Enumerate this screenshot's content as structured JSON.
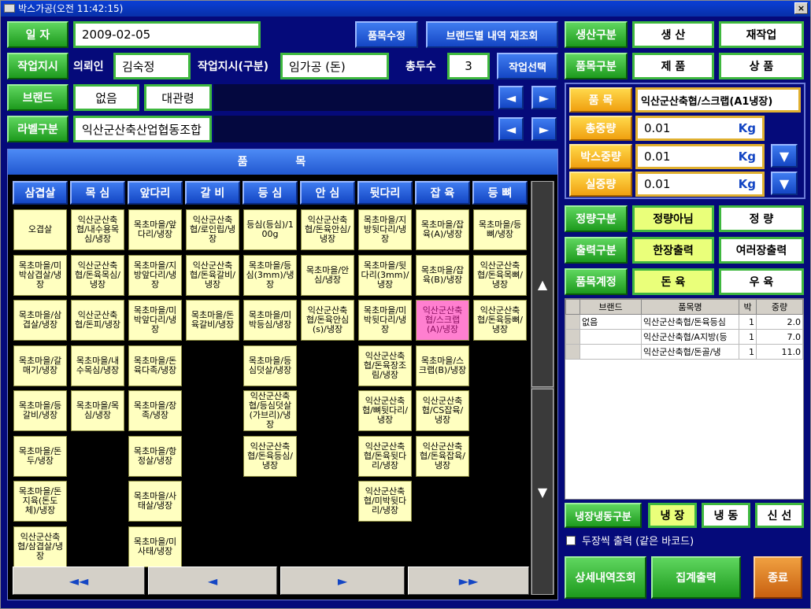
{
  "window": {
    "title": "박스가공(오전 11:42:15)",
    "close": "×"
  },
  "row1": {
    "date_label": "일 자",
    "date_value": "2009-02-05",
    "edit_btn": "품목수정",
    "brand_btn": "브랜드별 내역 재조회"
  },
  "row2": {
    "order_label": "작업지시",
    "client_label": "의뢰인",
    "client_value": "김숙정",
    "type_label": "작업지시(구분)",
    "type_value": "임가공 (돈)",
    "total_label": "총두수",
    "total_value": "3",
    "select_btn": "작업선택"
  },
  "row3": {
    "brand_label": "브랜드",
    "brand_value": "없음",
    "brand_value2": "대관령"
  },
  "row4": {
    "label_label": "라벨구분",
    "label_value": "익산군산축산업협동조합"
  },
  "right_top": {
    "prod_label": "생산구분",
    "prod_opt1": "생 산",
    "prod_opt2": "재작업",
    "item_label": "품목구분",
    "item_opt1": "제 품",
    "item_opt2": "상 품"
  },
  "weights": {
    "item_label": "품 목",
    "item_value": "익산군산축협/스크랩(A1냉장)",
    "total_label": "총중량",
    "total_value": "0.01",
    "box_label": "박스중량",
    "box_value": "0.01",
    "real_label": "실중량",
    "real_value": "0.01",
    "unit": "Kg"
  },
  "options": {
    "fixed_label": "정량구분",
    "fixed_opt1": "정량아님",
    "fixed_opt2": "정 량",
    "print_label": "출력구분",
    "print_opt1": "한장출력",
    "print_opt2": "여러장출력",
    "acct_label": "품목계정",
    "acct_opt1": "돈 육",
    "acct_opt2": "우 육"
  },
  "grid": {
    "headers": [
      "브랜드",
      "품목명",
      "박",
      "중량"
    ],
    "rows": [
      {
        "brand": "없음",
        "name": "익산군산축협/돈육등심",
        "box": "1",
        "weight": "2.0"
      },
      {
        "brand": "",
        "name": "익산군산축협/A지방(등",
        "box": "1",
        "weight": "7.0"
      },
      {
        "brand": "",
        "name": "익산군산축협/돈골/냉",
        "box": "1",
        "weight": "11.0"
      }
    ]
  },
  "storage": {
    "label": "냉장냉동구분",
    "opt1": "냉 장",
    "opt2": "냉 동",
    "opt3": "신 선"
  },
  "double_print": "두장씩 출력 (같은 바코드)",
  "bottom": {
    "detail": "상세내역조회",
    "summary": "집계출력",
    "exit": "종료"
  },
  "panel_title": "품 목",
  "categories": [
    "삼겹살",
    "목 심",
    "앞다리",
    "갈 비",
    "등 심",
    "안 심",
    "뒷다리",
    "잡 육",
    "등 뼈"
  ],
  "items": [
    [
      "오겹살",
      "목초마을/미박삼겹살/냉장",
      "목초마을/삼겹살/냉장",
      "목초마을/갈매기/냉장",
      "목초마을/등갈비/냉장",
      "목초마을/돈두/냉장",
      "목초마을/돈지육(돈도체)/냉장",
      "익산군산축협/삼겹살/냉장"
    ],
    [
      "익산군산축협/내수용목심/냉장",
      "익산군산축협/돈육목심/냉장",
      "익산군산축협/돈피/냉장",
      "목초마을/내수목심/냉장",
      "목초마을/목심/냉장"
    ],
    [
      "목초마을/앞다리/냉장",
      "목초마을/지방앞다리/냉장",
      "목초마을/미박앞다리/냉장",
      "목초마을/돈육다족/냉장",
      "목초마을/장족/냉장",
      "목초마을/항정살/냉장",
      "목초마을/사태살/냉장",
      "목초마을/미사태/냉장"
    ],
    [
      "익산군산축협/로인립/냉장",
      "익산군산축협/돈육갈비/냉장",
      "목초마을/돈육갈비/냉장"
    ],
    [
      "등심(등심)/100g",
      "목초마을/등심(3mm)/냉장",
      "목초마을/미박등심/냉장",
      "목초마을/등심덧살/냉장",
      "익산군산축협/등심덧살(가브리)/냉장",
      "익산군산축협/돈육등심/냉장"
    ],
    [
      "익산군산축협/돈육안심/냉장",
      "목초마을/안심/냉장",
      "익산군산축협/돈육안심(s)/냉장"
    ],
    [
      "목초마을/지방뒷다리/냉장",
      "목초마을/뒷다리(3mm)/냉장",
      "목초마을/미박뒷다리/냉장",
      "익산군산축협/돈육장조림/냉장",
      "익산군산축협/뼈뒷다리/냉장",
      "익산군산축협/돈육뒷다리/냉장",
      "익산군산축협/미박뒷다리/냉장"
    ],
    [
      "목초마을/잡육(A)/냉장",
      "목초마을/잡육(B)/냉장",
      "익산군산축협/스크랩(A)/냉장",
      "목초마을/스크랩(B)/냉장",
      "익산군산축협/CS잡육/냉장",
      "익산군산축협/돈육잡육/냉장"
    ],
    [
      "목초마을/등뼈/냉장",
      "익산군산축협/돈육목뼈/냉장",
      "익산군산축협/돈육등뼈/냉장"
    ]
  ],
  "selected_item": "익산군산축협/스크랩(A)/냉장",
  "pager": [
    "◄◄",
    "◄",
    "►",
    "►►"
  ],
  "icons": {
    "left": "◄",
    "right": "►",
    "down": "▼",
    "up": "▲"
  }
}
